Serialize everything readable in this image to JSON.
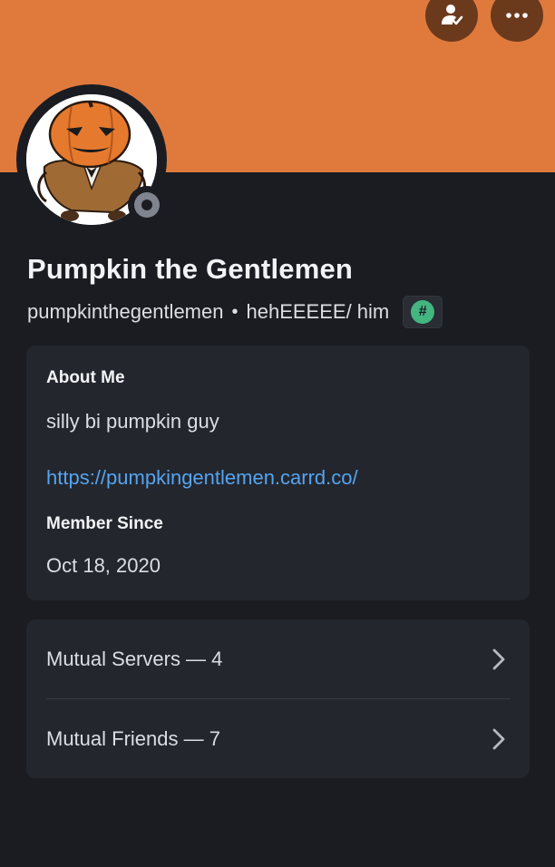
{
  "profile": {
    "display_name": "Pumpkin the Gentlemen",
    "username": "pumpkinthegentlemen",
    "separator": "•",
    "pronouns": "hehEEEEE/ him",
    "badge_icon": "hashtag-badge-icon",
    "status": "offline",
    "banner_color": "#e07a3c",
    "accent_color": "#6b3a1c"
  },
  "actions": {
    "friend_icon": "friend-check-icon",
    "more_icon": "more-dots-icon"
  },
  "about": {
    "heading": "About Me",
    "bio": "silly bi pumpkin guy",
    "link": "https://pumpkingentlemen.carrd.co/"
  },
  "member_since": {
    "heading": "Member Since",
    "date": "Oct 18, 2020"
  },
  "mutuals": {
    "servers_label": "Mutual Servers — 4",
    "friends_label": "Mutual Friends — 7"
  }
}
